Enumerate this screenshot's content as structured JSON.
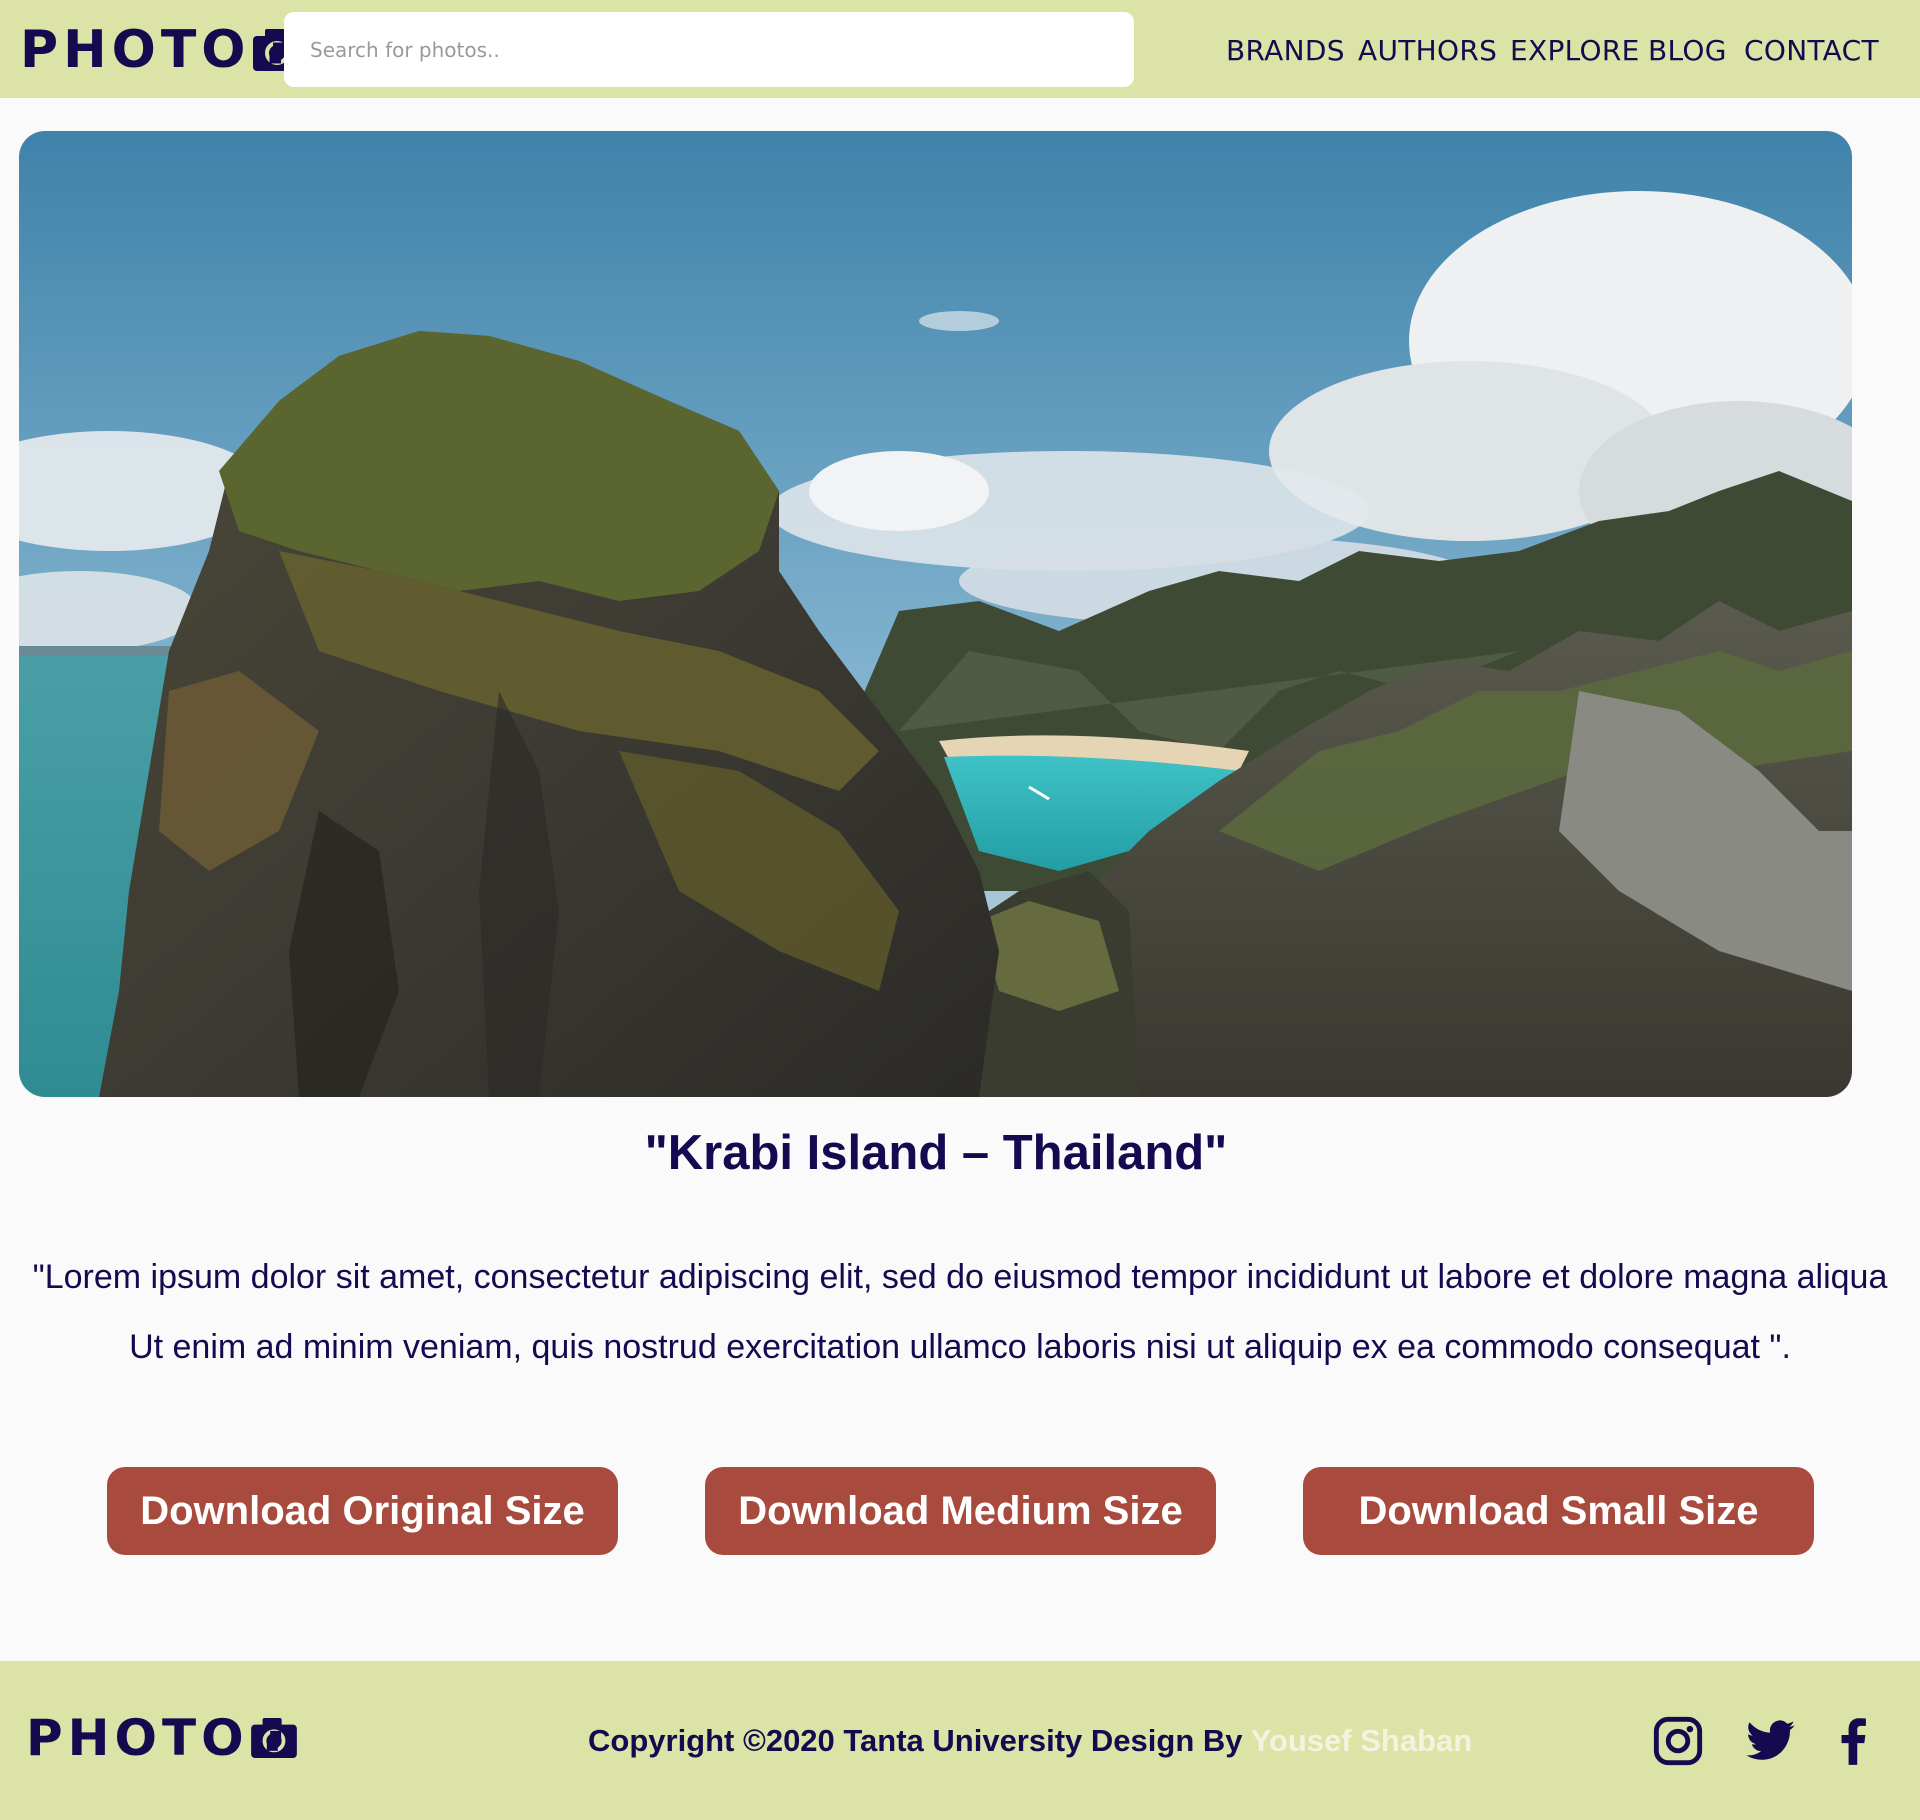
{
  "header": {
    "logo": "PHOTO",
    "search_placeholder": "Search for photos..",
    "nav": [
      "BRANDS",
      "AUTHORS",
      "EXPLORE",
      "BLOG",
      "CONTACT"
    ]
  },
  "photo": {
    "title": "\"Krabi Island – Thailand\"",
    "description": "\"Lorem ipsum dolor sit amet, consectetur adipiscing elit, sed do eiusmod tempor incididunt ut labore et dolore magna aliqua Ut enim ad minim veniam, quis nostrud exercitation ullamco laboris nisi ut aliquip ex ea commodo consequat \"."
  },
  "downloads": {
    "original": "Download Original Size",
    "medium": "Download Medium Size",
    "small": "Download Small Size"
  },
  "footer": {
    "logo": "PHOTO",
    "copyright": "Copyright ©2020 Tanta University Design By",
    "author": "Yousef Shaban",
    "social_icons": [
      "instagram-icon",
      "twitter-icon",
      "facebook-icon"
    ]
  },
  "colors": {
    "header_bg": "#dbe4a6",
    "brand_navy": "#150a4f",
    "button": "#a84b3e",
    "page_bg": "#fafafa",
    "author": "#f4f3e0"
  }
}
